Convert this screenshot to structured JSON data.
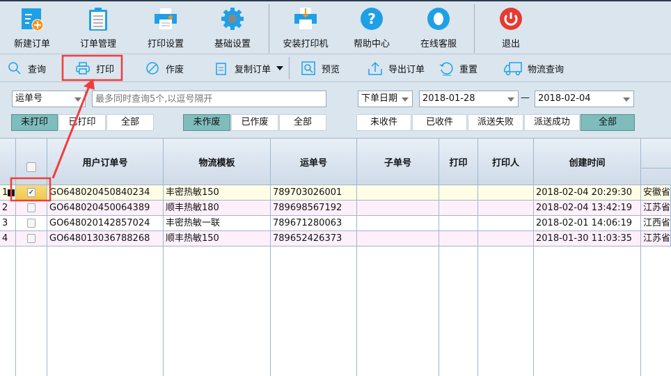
{
  "toolbar": [
    {
      "label": "新建订单",
      "icon": "new-order-icon"
    },
    {
      "label": "订单管理",
      "icon": "clipboard-icon"
    },
    {
      "label": "打印设置",
      "icon": "printer-settings-icon"
    },
    {
      "label": "基础设置",
      "icon": "gear-icon"
    },
    {
      "label": "安装打印机",
      "icon": "install-printer-icon"
    },
    {
      "label": "帮助中心",
      "icon": "help-icon"
    },
    {
      "label": "在线客服",
      "icon": "qq-icon"
    },
    {
      "label": "退出",
      "icon": "power-icon"
    }
  ],
  "actions": {
    "query": "查询",
    "print": "打印",
    "void": "作废",
    "copy": "复制订单",
    "preview": "预览",
    "export": "导出订单",
    "reset": "重置",
    "logistics": "物流查询"
  },
  "filters": {
    "search_type": "运单号",
    "search_placeholder": "最多同时查询5个,以逗号隔开",
    "date_type": "下单日期",
    "date_from": "2018-01-28",
    "date_sep": "—",
    "date_to": "2018-02-04",
    "print_status": [
      "未打印",
      "已打印",
      "全部"
    ],
    "void_status": [
      "未作废",
      "已作废",
      "全部"
    ],
    "delivery_status": [
      "未收件",
      "已收件",
      "派送失败",
      "派送成功",
      "全部"
    ]
  },
  "columns": [
    "用户订单号",
    "物流模板",
    "运单号",
    "子单号",
    "打印",
    "打印人",
    "创建时间"
  ],
  "rows": [
    {
      "n": "1",
      "checked": true,
      "order": "GO648020450840234",
      "tpl": "丰密热敏150",
      "waybill": "789703026001",
      "sub": "",
      "print": "",
      "printer": "",
      "created": "2018-02-04 20:29:30",
      "addr": "安徽省"
    },
    {
      "n": "2",
      "checked": false,
      "order": "GO648020450064389",
      "tpl": "顺丰热敏180",
      "waybill": "789698567192",
      "sub": "",
      "print": "",
      "printer": "",
      "created": "2018-02-04 13:42:19",
      "addr": "江苏省"
    },
    {
      "n": "3",
      "checked": false,
      "order": "GO648020142857024",
      "tpl": "丰密热敏一联",
      "waybill": "789671280063",
      "sub": "",
      "print": "",
      "printer": "",
      "created": "2018-02-01 14:06:19",
      "addr": "江西省"
    },
    {
      "n": "4",
      "checked": false,
      "order": "GO648013036788268",
      "tpl": "顺丰热敏150",
      "waybill": "789652426373",
      "sub": "",
      "print": "",
      "printer": "",
      "created": "2018-01-30 11:03:35",
      "addr": "江苏省"
    }
  ],
  "colors": {
    "accent": "#1ea0e6",
    "active_filter": "#7fbdbd",
    "annotation": "#f03c3c",
    "selected_row": "#fffde6",
    "alt_row": "#fdf0fb"
  }
}
